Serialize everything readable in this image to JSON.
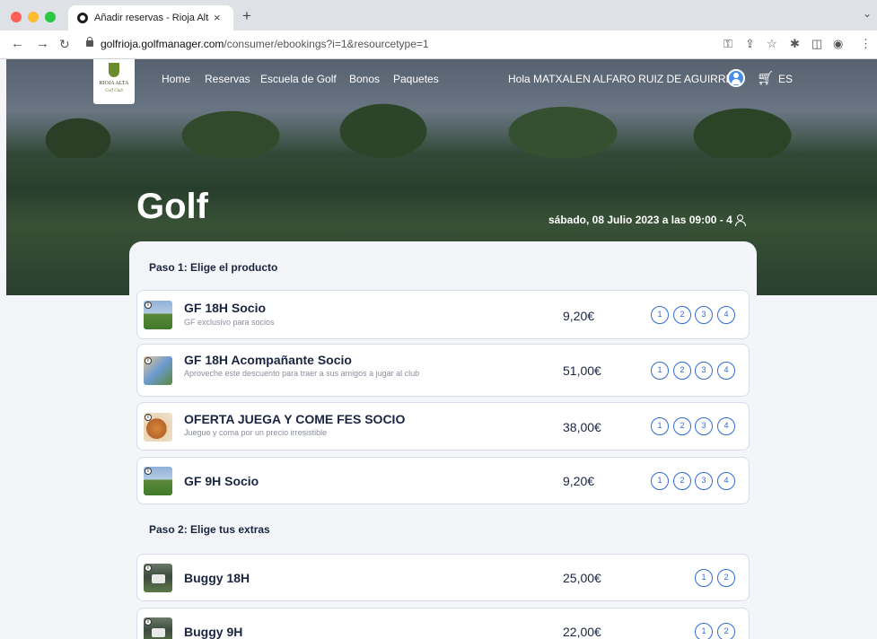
{
  "browser": {
    "tab_title": "Añadir reservas - Rioja Alta Go",
    "tab_close": "×",
    "new_tab": "+",
    "url_host": "golfrioja.golfmanager.com",
    "url_path": "/consumer/ebookings?i=1&resourcetype=1"
  },
  "site": {
    "logo_text": "RIOJA ALTA",
    "logo_sub": "Golf Club",
    "nav": [
      "Home",
      "Reservas",
      "Escuela de Golf",
      "Bonos",
      "Paquetes"
    ],
    "greeting": "Hola MATXALEN ALFARO RUIZ DE AGUIRRE",
    "language": "ES"
  },
  "hero": {
    "title": "Golf",
    "date": "sábado, 08 Julio 2023 a las 09:00 - 4"
  },
  "step1": {
    "title": "Paso 1: Elige el producto",
    "products": [
      {
        "title": "GF 18H Socio",
        "subtitle": "GF exclusivo para socios",
        "price": "9,20€",
        "quantities": [
          "1",
          "2",
          "3",
          "4"
        ],
        "thumb": "golf"
      },
      {
        "title": "GF 18H Acompañante Socio",
        "subtitle": "Aproveche este descuento para traer a sus amigos a jugar al club",
        "price": "51,00€",
        "quantities": [
          "1",
          "2",
          "3",
          "4"
        ],
        "thumb": "people"
      },
      {
        "title": "OFERTA JUEGA Y COME FES SOCIO",
        "subtitle": "Juegue y coma por un precio irresistible",
        "price": "38,00€",
        "quantities": [
          "1",
          "2",
          "3",
          "4"
        ],
        "thumb": "food"
      },
      {
        "title": "GF 9H Socio",
        "subtitle": "",
        "price": "9,20€",
        "quantities": [
          "1",
          "2",
          "3",
          "4"
        ],
        "thumb": "golf"
      }
    ]
  },
  "step2": {
    "title": "Paso 2: Elige tus extras",
    "extras": [
      {
        "title": "Buggy 18H",
        "price": "25,00€",
        "quantities": [
          "1",
          "2"
        ],
        "thumb": "buggy"
      },
      {
        "title": "Buggy 9H",
        "price": "22,00€",
        "quantities": [
          "1",
          "2"
        ],
        "thumb": "buggy"
      }
    ]
  },
  "colors": {
    "accent": "#2f6bd8",
    "text_dark": "#1b2540",
    "page_bg": "#f3f5f9"
  }
}
